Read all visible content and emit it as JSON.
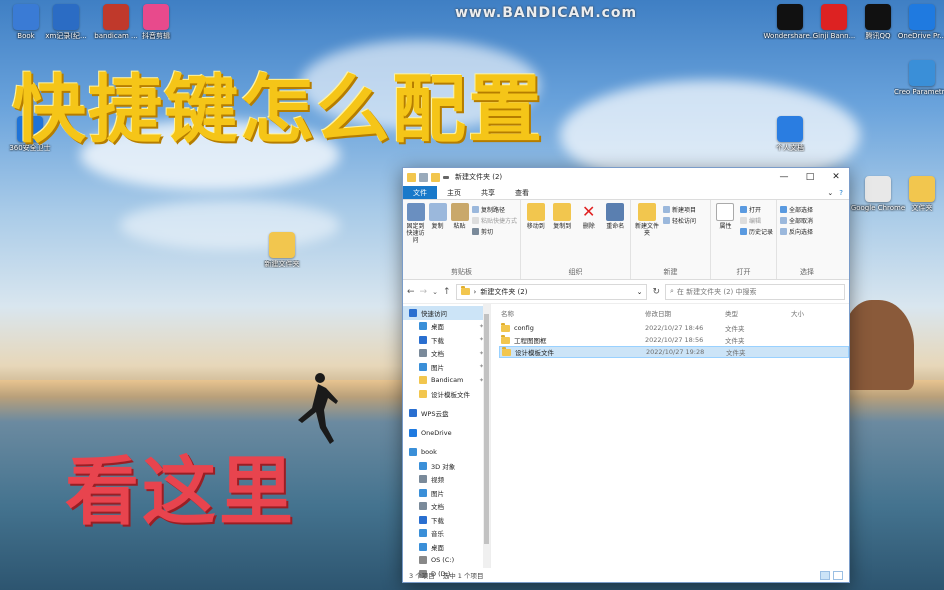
{
  "watermark": "www.BANDICAM.com",
  "overlay": {
    "title": "快捷键怎么配置",
    "look": "看这里"
  },
  "desktop_icons": [
    {
      "label": "Book",
      "color": "#3a7bd5"
    },
    {
      "label": "xm记录(纪...",
      "color": "#2b6cc4"
    },
    {
      "label": "bandicam ...",
      "color": "#c0392b"
    },
    {
      "label": "抖音剪辑",
      "color": "#e84a8c"
    },
    {
      "label": "Wondershare...",
      "color": "#111"
    },
    {
      "label": "Ginji Bann...",
      "color": "#d22"
    },
    {
      "label": "腾讯QQ",
      "color": "#111"
    },
    {
      "label": "OneDrive Pr...",
      "color": "#1f7ae0"
    },
    {
      "label": "360安全卫士",
      "color": "#1e73d8"
    },
    {
      "label": "个人文档",
      "color": "#2a7de1"
    },
    {
      "label": "Creo Parametr...",
      "color": "#3a8fd8"
    },
    {
      "label": "Google Chrome",
      "color": "#e8e8e8"
    },
    {
      "label": "文件夹",
      "color": "#f2c64e"
    },
    {
      "label": "新建文件夹",
      "color": "#f2c64e"
    }
  ],
  "explorer": {
    "title": "新建文件夹 (2)",
    "controls": {
      "minimize": "—",
      "maximize": "□",
      "close": "✕"
    },
    "tabs": [
      "文件",
      "主页",
      "共享",
      "查看"
    ],
    "ribbon": {
      "clipboard": {
        "group": "剪贴板",
        "pin": "固定到快速访问",
        "copy": "复制",
        "paste": "粘贴",
        "copy_path": "复制路径",
        "paste_shortcut": "粘贴快捷方式",
        "cut": "剪切"
      },
      "organize": {
        "group": "组织",
        "move_to": "移动到",
        "copy_to": "复制到",
        "delete": "删除",
        "rename": "重命名"
      },
      "new": {
        "group": "新建",
        "new_folder": "新建文件夹",
        "new_item": "新建项目",
        "easy_access": "轻松访问"
      },
      "open": {
        "group": "打开",
        "properties": "属性",
        "open": "打开",
        "edit": "编辑",
        "history": "历史记录"
      },
      "select": {
        "group": "选择",
        "select_all": "全部选择",
        "select_none": "全部取消",
        "invert": "反向选择"
      }
    },
    "address": {
      "path": "新建文件夹 (2)",
      "search_placeholder": "在 新建文件夹 (2) 中搜索"
    },
    "nav": [
      {
        "label": "快速访问",
        "indent": 0,
        "sel": true,
        "color": "#2a6fd0"
      },
      {
        "label": "桌面",
        "indent": 1,
        "pin": true,
        "color": "#3a8fd8"
      },
      {
        "label": "下载",
        "indent": 1,
        "pin": true,
        "color": "#2a6fd0"
      },
      {
        "label": "文档",
        "indent": 1,
        "pin": true,
        "color": "#7a8a9a"
      },
      {
        "label": "图片",
        "indent": 1,
        "pin": true,
        "color": "#3a8fd8"
      },
      {
        "label": "Bandicam",
        "indent": 1,
        "pin": true,
        "color": "#f2c64e"
      },
      {
        "label": "设计模板文件",
        "indent": 1,
        "pin": false,
        "color": "#f2c64e"
      },
      {
        "label": "",
        "indent": 0,
        "pin": false,
        "color": ""
      },
      {
        "label": "WPS云盘",
        "indent": 0,
        "pin": false,
        "color": "#2a6fd0"
      },
      {
        "label": "",
        "indent": 0,
        "pin": false,
        "color": ""
      },
      {
        "label": "OneDrive",
        "indent": 0,
        "pin": false,
        "color": "#1f7ae0"
      },
      {
        "label": "",
        "indent": 0,
        "pin": false,
        "color": ""
      },
      {
        "label": "book",
        "indent": 0,
        "pin": false,
        "color": "#3a8fd8"
      },
      {
        "label": "3D 对象",
        "indent": 1,
        "pin": false,
        "color": "#3a8fd8"
      },
      {
        "label": "视频",
        "indent": 1,
        "pin": false,
        "color": "#7a8a9a"
      },
      {
        "label": "图片",
        "indent": 1,
        "pin": false,
        "color": "#3a8fd8"
      },
      {
        "label": "文档",
        "indent": 1,
        "pin": false,
        "color": "#7a8a9a"
      },
      {
        "label": "下载",
        "indent": 1,
        "pin": false,
        "color": "#2a6fd0"
      },
      {
        "label": "音乐",
        "indent": 1,
        "pin": false,
        "color": "#3a8fd8"
      },
      {
        "label": "桌面",
        "indent": 1,
        "pin": false,
        "color": "#3a8fd8"
      },
      {
        "label": "OS (C:)",
        "indent": 1,
        "pin": false,
        "color": "#888"
      },
      {
        "label": "D (D:)",
        "indent": 1,
        "pin": false,
        "color": "#888"
      }
    ],
    "columns": {
      "name": "名称",
      "date": "修改日期",
      "type": "类型",
      "size": "大小"
    },
    "files": [
      {
        "name": "config",
        "date": "2022/10/27 18:46",
        "type": "文件夹",
        "sel": false
      },
      {
        "name": "工程图图框",
        "date": "2022/10/27 18:56",
        "type": "文件夹",
        "sel": false
      },
      {
        "name": "设计模板文件",
        "date": "2022/10/27 19:28",
        "type": "文件夹",
        "sel": true
      }
    ],
    "status": {
      "count": "3 个项目",
      "selected": "选中 1 个项目"
    }
  }
}
